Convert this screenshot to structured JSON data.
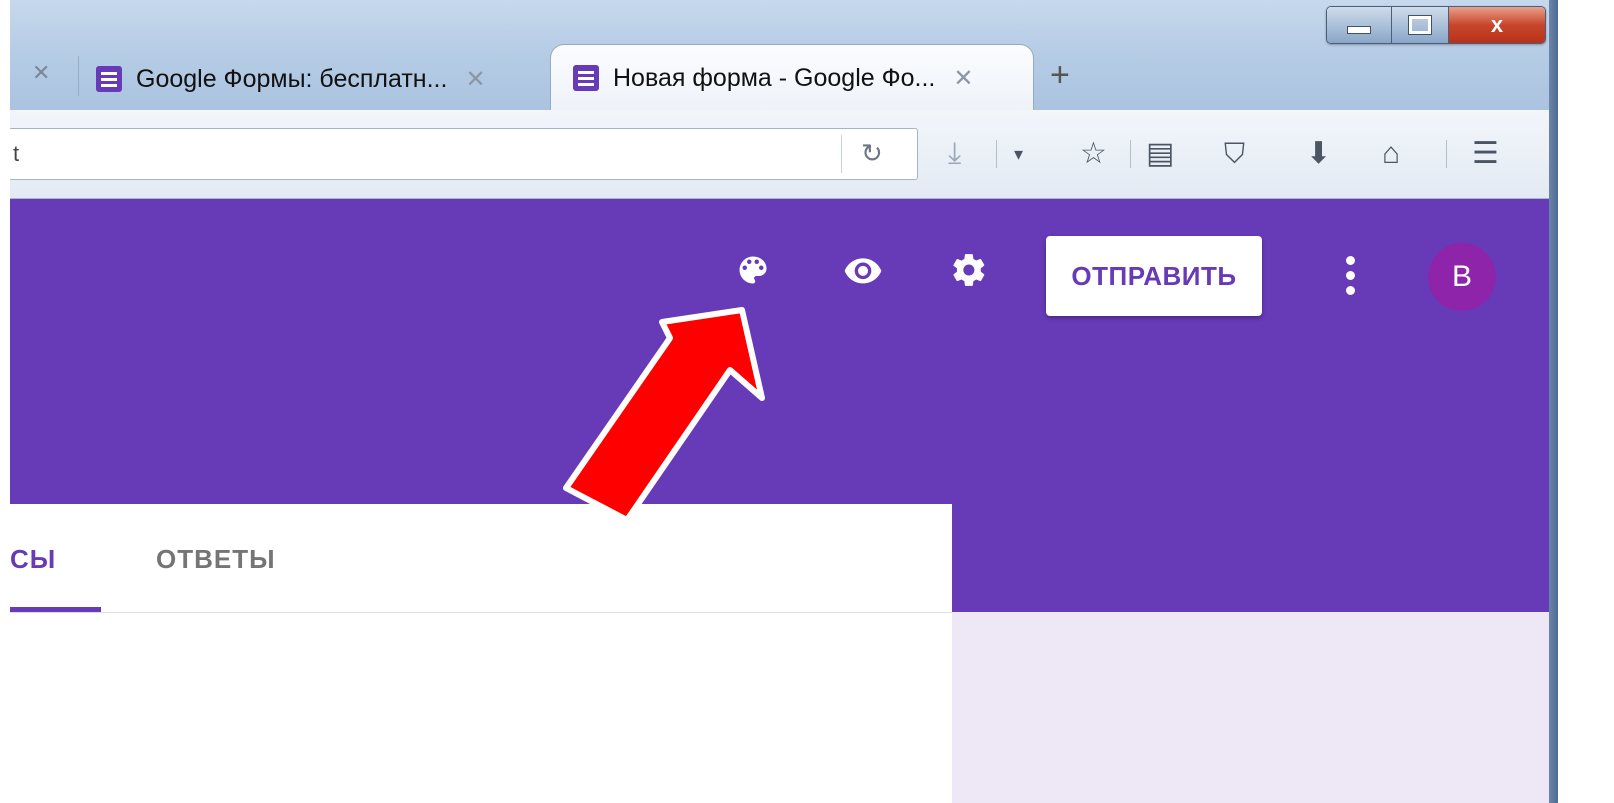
{
  "window": {
    "buttons": {
      "minimize": "",
      "maximize": "",
      "close": "x"
    }
  },
  "tabs": [
    {
      "label": "Google Формы: бесплатн...",
      "close": "✕"
    },
    {
      "label": "Новая форма - Google Фо...",
      "close": "✕",
      "active": true
    }
  ],
  "new_tab_label": "+",
  "toolbar": {
    "url_fragment": "t",
    "icons": [
      "reload-icon",
      "download-icon",
      "dropdown-icon",
      "bookmark-star-icon",
      "reading-list-icon",
      "pocket-icon",
      "downloads-icon",
      "home-icon",
      "menu-icon"
    ]
  },
  "form_header": {
    "send_label": "ОТПРАВИТЬ",
    "avatar_letter": "B",
    "icons": [
      "palette-icon",
      "preview-eye-icon",
      "settings-gear-icon",
      "more-vert-icon"
    ]
  },
  "form_tabs": {
    "questions_partial": "СЫ",
    "answers": "ОТВЕТЫ"
  },
  "colors": {
    "brand": "#673ab7",
    "background_light": "#ede7f6",
    "avatar": "#8e24aa",
    "arrow": "#ff0000"
  }
}
